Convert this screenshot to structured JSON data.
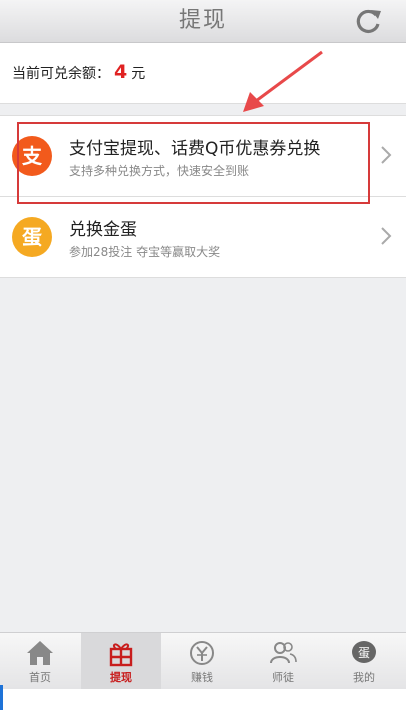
{
  "header": {
    "title": "提现",
    "refresh_icon": "refresh-icon"
  },
  "balance": {
    "label": "当前可兑余额：",
    "amount": "4",
    "unit": "元"
  },
  "options": [
    {
      "icon_char": "支",
      "icon_color": "#f25a1c",
      "title": "支付宝提现、话费Q币优惠券兑换",
      "subtitle": "支持多种兑换方式，快速安全到账"
    },
    {
      "icon_char": "蛋",
      "icon_color": "#f5a922",
      "title": "兑换金蛋",
      "subtitle": "参加28投注 夺宝等赢取大奖"
    }
  ],
  "tabs": [
    {
      "label": "首页",
      "icon": "home-icon"
    },
    {
      "label": "提现",
      "icon": "gift-icon",
      "active": true
    },
    {
      "label": "赚钱",
      "icon": "yen-icon"
    },
    {
      "label": "师徒",
      "icon": "people-icon"
    },
    {
      "label": "我的",
      "icon": "egg-icon"
    }
  ],
  "colors": {
    "accent": "#c81d1d",
    "highlight_box": "#d63a3a"
  }
}
